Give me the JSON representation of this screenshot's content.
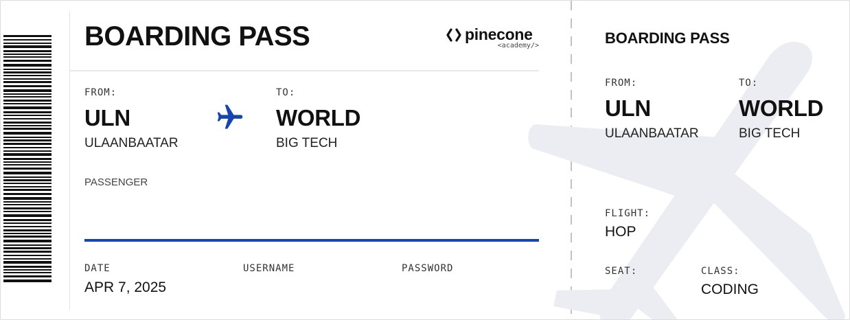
{
  "colors": {
    "accent": "#1745b0",
    "watermark": "#ecedf2",
    "text": "#111111"
  },
  "logo": {
    "icon": "pinecone-logo-icon",
    "name": "pinecone",
    "subtitle": "<academy/>"
  },
  "main": {
    "title": "BOARDING PASS",
    "from_label": "FROM:",
    "from_code": "ULN",
    "from_city": "ULAANBAATAR",
    "to_label": "TO:",
    "to_code": "WORLD",
    "to_city": "BIG TECH",
    "passenger_label": "PASSENGER",
    "passenger_name": "",
    "date_label": "DATE",
    "date_value": "APR 7, 2025",
    "username_label": "USERNAME",
    "username_value": "",
    "password_label": "PASSWORD",
    "password_value": ""
  },
  "stub": {
    "title": "BOARDING PASS",
    "from_label": "FROM:",
    "from_code": "ULN",
    "from_city": "ULAANBAATAR",
    "to_label": "TO:",
    "to_code": "WORLD",
    "to_city": "BIG TECH",
    "flight_label": "FLIGHT:",
    "flight_value": "HOP",
    "seat_label": "SEAT:",
    "seat_value": "",
    "class_label": "CLASS:",
    "class_value": "CODING"
  }
}
